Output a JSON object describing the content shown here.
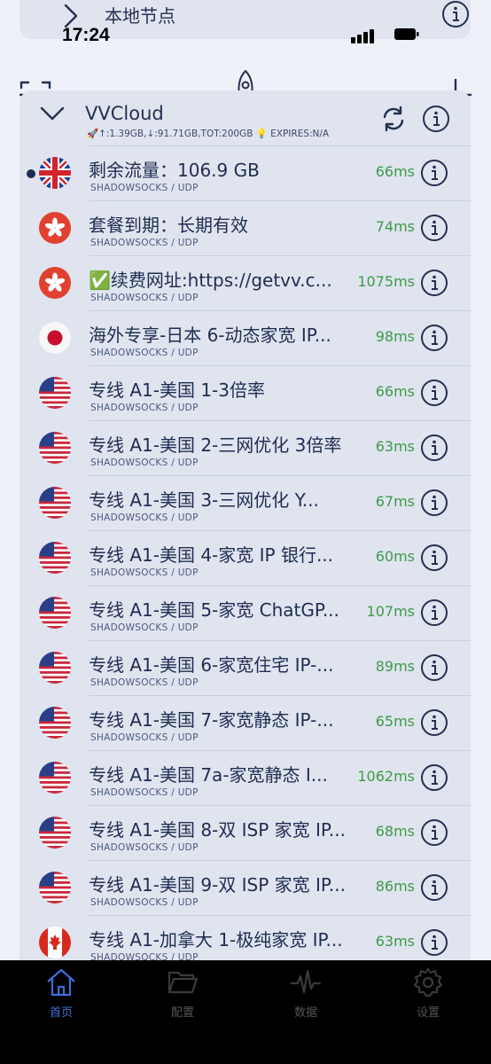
{
  "status_bar": {
    "time": "17:24"
  },
  "local_group": {
    "title": "本地节点"
  },
  "group": {
    "name": "VVCloud",
    "stats": "🚀↑:1.39GB,↓:91.71GB,TOT:200GB 💡 EXPIRES:N/A"
  },
  "nodes": [
    {
      "name": "剩余流量：106.9 GB",
      "protocol": "SHADOWSOCKS / UDP",
      "latency": "66ms",
      "flag": "gb",
      "selected": true
    },
    {
      "name": "套餐到期：长期有效",
      "protocol": "SHADOWSOCKS / UDP",
      "latency": "74ms",
      "flag": "hk"
    },
    {
      "name": "✅续费网址:https://getvv.c...",
      "protocol": "SHADOWSOCKS / UDP",
      "latency": "1075ms",
      "flag": "hk"
    },
    {
      "name": "海外专享-日本 6-动态家宽 IP...",
      "protocol": "SHADOWSOCKS / UDP",
      "latency": "98ms",
      "flag": "jp"
    },
    {
      "name": "专线 A1-美国 1-3倍率",
      "protocol": "SHADOWSOCKS / UDP",
      "latency": "66ms",
      "flag": "us"
    },
    {
      "name": "专线 A1-美国 2-三网优化 3倍率",
      "protocol": "SHADOWSOCKS / UDP",
      "latency": "63ms",
      "flag": "us"
    },
    {
      "name": "专线 A1-美国 3-三网优化 Y...",
      "protocol": "SHADOWSOCKS / UDP",
      "latency": "67ms",
      "flag": "us"
    },
    {
      "name": "专线 A1-美国 4-家宽 IP 银行...",
      "protocol": "SHADOWSOCKS / UDP",
      "latency": "60ms",
      "flag": "us"
    },
    {
      "name": "专线 A1-美国 5-家宽 ChatGP...",
      "protocol": "SHADOWSOCKS / UDP",
      "latency": "107ms",
      "flag": "us"
    },
    {
      "name": "专线 A1-美国 6-家宽住宅 IP-...",
      "protocol": "SHADOWSOCKS / UDP",
      "latency": "89ms",
      "flag": "us"
    },
    {
      "name": "专线 A1-美国 7-家宽静态 IP-...",
      "protocol": "SHADOWSOCKS / UDP",
      "latency": "65ms",
      "flag": "us"
    },
    {
      "name": "专线 A1-美国 7a-家宽静态 I...",
      "protocol": "SHADOWSOCKS / UDP",
      "latency": "1062ms",
      "flag": "us"
    },
    {
      "name": "专线 A1-美国 8-双 ISP 家宽 IP...",
      "protocol": "SHADOWSOCKS / UDP",
      "latency": "68ms",
      "flag": "us"
    },
    {
      "name": "专线 A1-美国 9-双 ISP 家宽 IP...",
      "protocol": "SHADOWSOCKS / UDP",
      "latency": "86ms",
      "flag": "us"
    },
    {
      "name": "专线 A1-加拿大 1-极纯家宽 IP...",
      "protocol": "SHADOWSOCKS / UDP",
      "latency": "63ms",
      "flag": "ca"
    }
  ],
  "tabs": [
    {
      "label": "首页",
      "icon": "home-icon",
      "active": true
    },
    {
      "label": "配置",
      "icon": "folder-icon",
      "active": false
    },
    {
      "label": "数据",
      "icon": "pulse-icon",
      "active": false
    },
    {
      "label": "设置",
      "icon": "gear-icon",
      "active": false
    }
  ],
  "colors": {
    "latency": "#3f9a49",
    "accent": "#3e6fd8",
    "text": "#1f2d50"
  }
}
